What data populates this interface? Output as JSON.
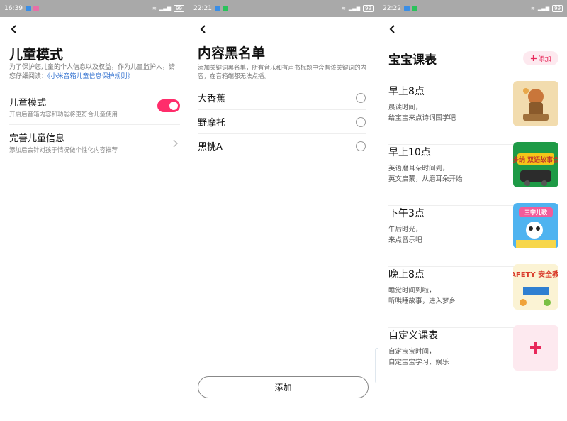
{
  "panels": {
    "child_mode": {
      "status_time": "16:39",
      "title": "儿童模式",
      "desc_text": "为了保护您儿童的个人信息以及权益，作为儿童监护人，请您仔细阅读：",
      "desc_link": "《小米音箱儿童信息保护规则》",
      "settings": [
        {
          "label": "儿童模式",
          "sub": "开启后音箱内容和功能将更符合儿童使用",
          "enabled": true
        },
        {
          "label": "完善儿童信息",
          "sub": "添加后会针对孩子情况做个性化内容推荐"
        }
      ]
    },
    "blacklist": {
      "status_time": "22:21",
      "title": "内容黑名单",
      "desc": "添加关键词黑名单，所有音乐和有声书标题中含有该关键词的内容，在音箱端都无法点播。",
      "items": [
        "大香蕉",
        "野摩托",
        "黑桃A"
      ],
      "add_label": "添加"
    },
    "schedule": {
      "status_time": "22:22",
      "title": "宝宝课表",
      "add_label": "添加",
      "items": [
        {
          "title": "早上8点",
          "line1": "晨读时间，",
          "line2": "给宝宝来点诗词国学吧",
          "thumb_text": ""
        },
        {
          "title": "早上10点",
          "line1": "英语磨耳朵时间到，",
          "line2": "英文启蒙，从磨耳朵开始",
          "thumb_text": "多纳 双语故事会"
        },
        {
          "title": "下午3点",
          "line1": "午后时光，",
          "line2": "来点音乐吧",
          "thumb_text": "三字儿歌"
        },
        {
          "title": "晚上8点",
          "line1": "睡觉时间到啦，",
          "line2": "听哄睡故事，进入梦乡",
          "thumb_text": "SAFETY 安全教育"
        },
        {
          "title": "自定义课表",
          "line1": "自定宝宝时间，",
          "line2": "自定宝宝学习、娱乐"
        }
      ]
    }
  },
  "status": {
    "battery": "99"
  },
  "colors": {
    "accent": "#ff2d6b",
    "link": "#2f6fcf",
    "statusbar": "#a9a9a9"
  },
  "icons": [
    "back-arrow-icon",
    "chevron-right-icon",
    "radio-icon",
    "plus-icon",
    "wifi-icon",
    "signal-icon",
    "battery-icon"
  ]
}
